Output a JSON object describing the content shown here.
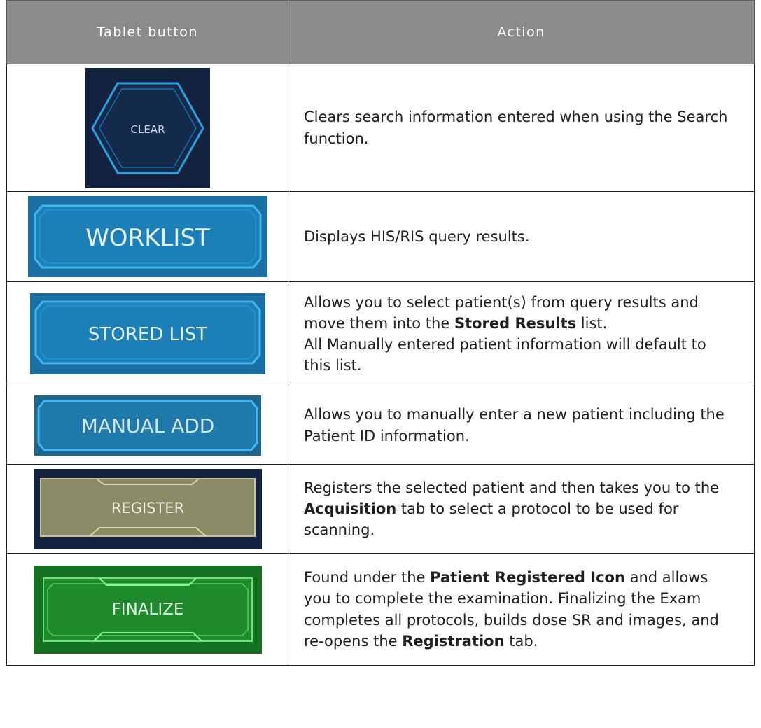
{
  "header": {
    "col1": "Tablet button",
    "col2": "Action"
  },
  "rows": [
    {
      "button": "CLEAR",
      "icon": "clear-hexagon-button",
      "action": [
        "Clears search information entered when using the Search function."
      ]
    },
    {
      "button": "WORKLIST",
      "icon": "worklist-button",
      "action": [
        "Displays HIS/RIS query results."
      ]
    },
    {
      "button": "STORED LIST",
      "icon": "stored-list-button",
      "action_pre": "Allows you to select patient(s) from query results and move them into the ",
      "action_bold": "Stored Results",
      "action_post": " list.",
      "action_line2": "All Manually entered patient information will default to this list."
    },
    {
      "button": "MANUAL ADD",
      "icon": "manual-add-button",
      "action": [
        "Allows you to manually enter a new patient including the Patient ID information."
      ]
    },
    {
      "button": "REGISTER",
      "icon": "register-button",
      "action_pre": "Registers the selected patient and then takes you to the ",
      "action_bold": "Acquisition",
      "action_post": " tab to select a protocol to be used for scanning."
    },
    {
      "button": "FINALIZE",
      "icon": "finalize-button",
      "action_pre": "Found under the ",
      "action_bold": "Patient Registered Icon",
      "action_mid": " and allows you to complete the examination. Finalizing the Exam completes all protocols, builds dose SR and images, and re-opens the ",
      "action_bold2": "Registration",
      "action_post": " tab."
    }
  ],
  "colors": {
    "header_bg": "#8b8b8b",
    "blue_button": "#1d7fb8",
    "navy_bg": "#13233f",
    "register_tan": "#8b8a66",
    "finalize_green": "#1e8a2c"
  }
}
